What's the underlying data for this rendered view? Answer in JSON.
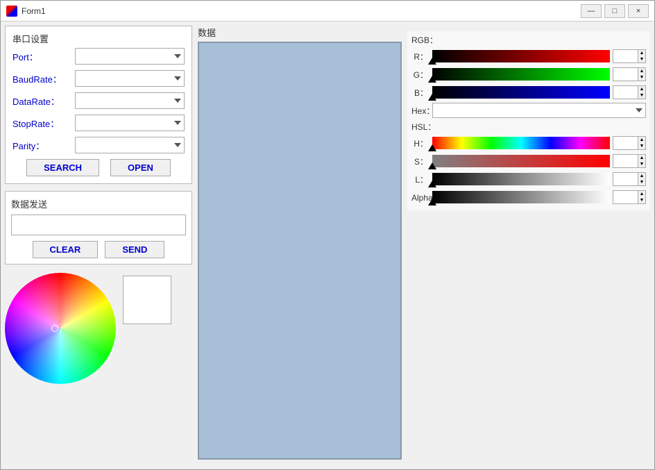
{
  "window": {
    "title": "Form1",
    "icon": "app-icon"
  },
  "title_buttons": {
    "minimize": "—",
    "maximize": "□",
    "close": "×"
  },
  "serial": {
    "section_title": "串口设置",
    "port_label": "Port：",
    "baudrate_label": "BaudRate：",
    "datarate_label": "DataRate：",
    "stoprate_label": "StopRate：",
    "parity_label": "Parity：",
    "search_label": "SEARCH",
    "open_label": "OPEN"
  },
  "data_section": {
    "title": "数据"
  },
  "send_section": {
    "title": "数据发送",
    "clear_label": "CLEAR",
    "send_label": "SEND"
  },
  "rgb_section": {
    "title": "RGB：",
    "r_label": "R：",
    "g_label": "G：",
    "b_label": "B：",
    "hex_label": "Hex：",
    "hsl_title": "HSL：",
    "h_label": "H：",
    "s_label": "S：",
    "l_label": "L：",
    "alpha_label": "Alpha："
  },
  "spinbox_values": {
    "r": "0",
    "g": "0",
    "b": "0",
    "h": "0",
    "s": "0",
    "l": "0",
    "alpha": "0"
  },
  "palette": {
    "colors": [
      "#000000",
      "#000066",
      "#000099",
      "#0000cc",
      "#0000ff",
      "#006600",
      "#006633",
      "#006666",
      "#006699",
      "#0066cc",
      "#0066ff",
      "#009900",
      "#009933",
      "#009966",
      "#009999",
      "#0099cc",
      "#0099ff",
      "#00cc00",
      "#00cc33",
      "#00cc66",
      "#00cc99",
      "#00cccc",
      "#00ccff",
      "#00ff00",
      "#00ff33",
      "#00ff66",
      "#00ff99",
      "#00ffcc",
      "#00ffff",
      "#330000",
      "#330033",
      "#330066",
      "#330099",
      "#3300cc",
      "#3300ff",
      "#333300",
      "#333333",
      "#333366",
      "#333399",
      "#3333cc",
      "#3333ff",
      "#336600",
      "#336633",
      "#336666",
      "#336699",
      "#3366cc",
      "#3366ff",
      "#339900",
      "#339933",
      "#339966",
      "#339999",
      "#3399cc",
      "#3399ff",
      "#33cc00",
      "#33cc33",
      "#33cc66",
      "#33cc99",
      "#33cccc",
      "#33ccff",
      "#33ff00",
      "#33ff33",
      "#33ff66",
      "#33ff99",
      "#33ffcc",
      "#33ffff",
      "#660000",
      "#660033",
      "#660066",
      "#660099",
      "#6600cc",
      "#6600ff",
      "#663300",
      "#663333",
      "#663366",
      "#663399",
      "#6633cc",
      "#6633ff",
      "#666600",
      "#666633",
      "#666666",
      "#666699",
      "#6666cc",
      "#6666ff",
      "#669900",
      "#669933",
      "#669966",
      "#669999",
      "#6699cc",
      "#6699ff",
      "#66cc00",
      "#66cc33",
      "#66cc66",
      "#66cc99",
      "#66cccc",
      "#66ccff",
      "#66ff00",
      "#66ff33",
      "#66ff66",
      "#66ff99",
      "#66ffcc",
      "#66ffff",
      "#990000",
      "#990033",
      "#990066",
      "#990099",
      "#9900cc",
      "#9900ff",
      "#993300",
      "#993333",
      "#993366",
      "#993399",
      "#9933cc",
      "#9933ff",
      "#996600",
      "#996633",
      "#996666",
      "#996699",
      "#9966cc",
      "#9966ff",
      "#999900",
      "#999933",
      "#999966",
      "#999999",
      "#9999cc",
      "#9999ff",
      "#99cc00",
      "#99cc33",
      "#99cc66",
      "#99cc99",
      "#99cccc",
      "#99ccff",
      "#99ff00",
      "#99ff33",
      "#99ff66",
      "#99ff99",
      "#99ffcc",
      "#99ffff",
      "#cc0000",
      "#cc0033",
      "#cc0066",
      "#cc0099",
      "#cc00cc",
      "#cc00ff",
      "#cc3300",
      "#cc3333",
      "#cc3366",
      "#cc3399",
      "#cc33cc",
      "#cc33ff",
      "#cc6600",
      "#cc6633",
      "#cc6666",
      "#cc6699",
      "#cc66cc",
      "#cc66ff",
      "#cc9900",
      "#cc9933",
      "#cc9966",
      "#cc9999",
      "#cc99cc",
      "#cc99ff",
      "#cccc00",
      "#cccc33",
      "#cccc66",
      "#cccc99",
      "#cccccc",
      "#ccccff",
      "#ccff00",
      "#ccff33",
      "#ccff66",
      "#ccff99",
      "#ccffcc",
      "#ccffff",
      "#ff0000",
      "#ff0033",
      "#ff0066",
      "#ff0099",
      "#ff00cc",
      "#ff00ff",
      "#ff3300",
      "#ff3333",
      "#ff3366",
      "#ff3399",
      "#ff33cc",
      "#ff33ff",
      "#ff6600",
      "#ff6633",
      "#ff6666",
      "#ff6699",
      "#ff66cc",
      "#ff66ff",
      "#ff9900",
      "#ff9933",
      "#ff9966",
      "#ff9999",
      "#ff99cc",
      "#ff99ff",
      "#ffcc00",
      "#ffcc33",
      "#ffcc66",
      "#ffcc99",
      "#ffcccc",
      "#ffccff",
      "#ffff00",
      "#ffff33",
      "#ffff66",
      "#ffff99",
      "#ffffcc",
      "#ffffff",
      "#dddddd",
      "#cccccc",
      "#bbbbbb",
      "#aaaaaa",
      "#999999",
      "#888888",
      "#777777",
      "#666666",
      "#555555",
      "#444444",
      "#333333",
      "#222222",
      "#111111",
      "#000000",
      "#ffffff",
      "#eeeeee",
      "#dddddd",
      "#cccccc",
      "#bbbbbb",
      "#aaaaaa",
      "#999999",
      "#888888",
      "#777777",
      "#666666",
      "#555555",
      "#444444",
      "#333333",
      "#222222"
    ]
  }
}
